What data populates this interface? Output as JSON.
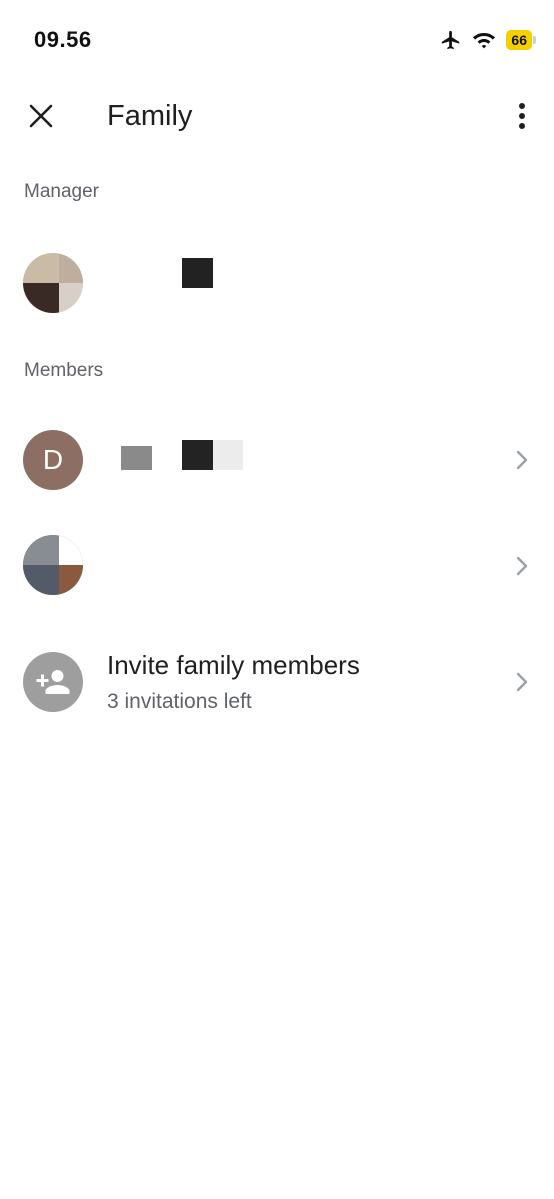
{
  "status": {
    "time": "09.56",
    "battery": "66"
  },
  "header": {
    "title": "Family"
  },
  "sections": {
    "manager": "Manager",
    "members": "Members"
  },
  "members": [
    {
      "avatar_initial": "D",
      "avatar_color": "#8d6e63"
    }
  ],
  "invite": {
    "title": "Invite family members",
    "subtitle": "3 invitations left"
  },
  "colors": {
    "text_primary": "#1f1f1f",
    "text_secondary": "#5f6368",
    "chevron": "#9aa0a6",
    "battery": "#f5d000"
  },
  "icons": [
    "close-icon",
    "more-vert-icon",
    "airplane-icon",
    "wifi-icon",
    "battery-icon",
    "chevron-right-icon",
    "person-add-icon"
  ]
}
